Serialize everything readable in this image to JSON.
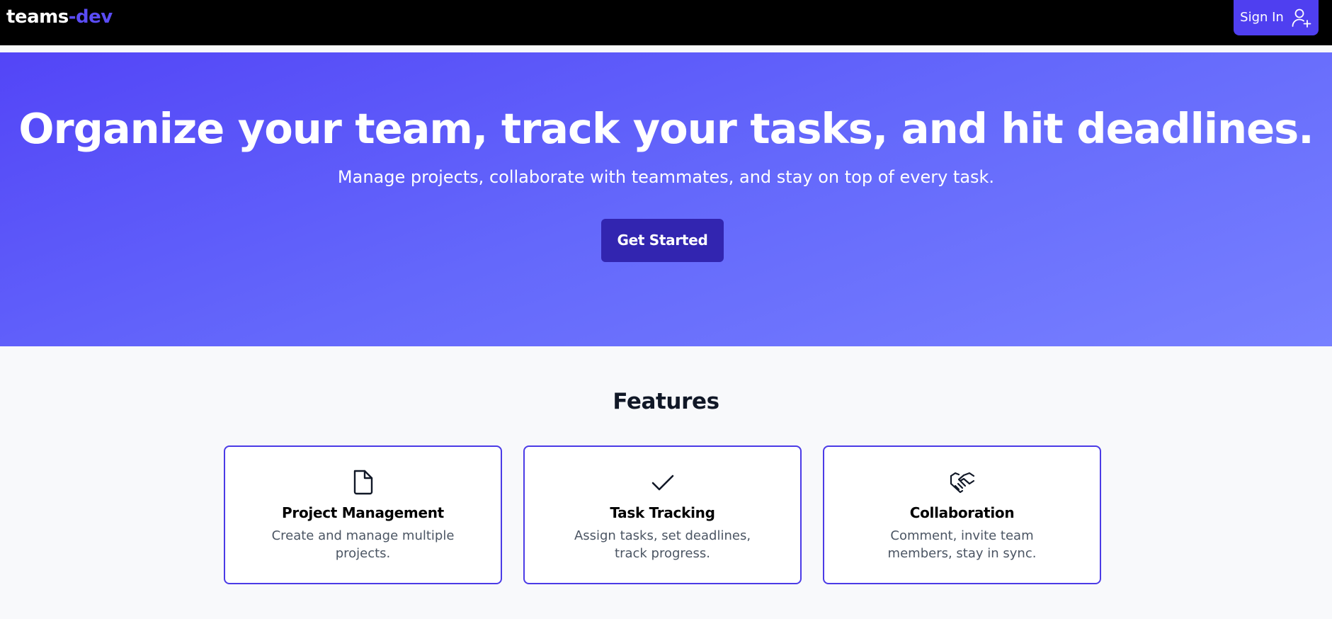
{
  "navbar": {
    "brand_part1": "teams",
    "brand_part2": "-dev",
    "signin_label": "Sign In",
    "signin_icon": "user-plus-icon"
  },
  "hero": {
    "title": "Organize your team, track your tasks, and hit deadlines.",
    "subtitle": "Manage projects, collaborate with teammates, and stay on top of every task.",
    "cta_label": "Get Started"
  },
  "features": {
    "heading": "Features",
    "cards": [
      {
        "icon": "document-icon",
        "title": "Project Management",
        "description": "Create and manage multiple projects."
      },
      {
        "icon": "checkmark-icon",
        "title": "Task Tracking",
        "description": "Assign tasks, set deadlines, track progress."
      },
      {
        "icon": "handshake-icon",
        "title": "Collaboration",
        "description": "Comment, invite team members, stay in sync."
      }
    ]
  },
  "colors": {
    "accent": "#4f3ff0",
    "hero_gradient_start": "#5345f7",
    "hero_gradient_end": "#7780ff",
    "cta_background": "#3225b0",
    "card_border": "#4b3be6"
  }
}
